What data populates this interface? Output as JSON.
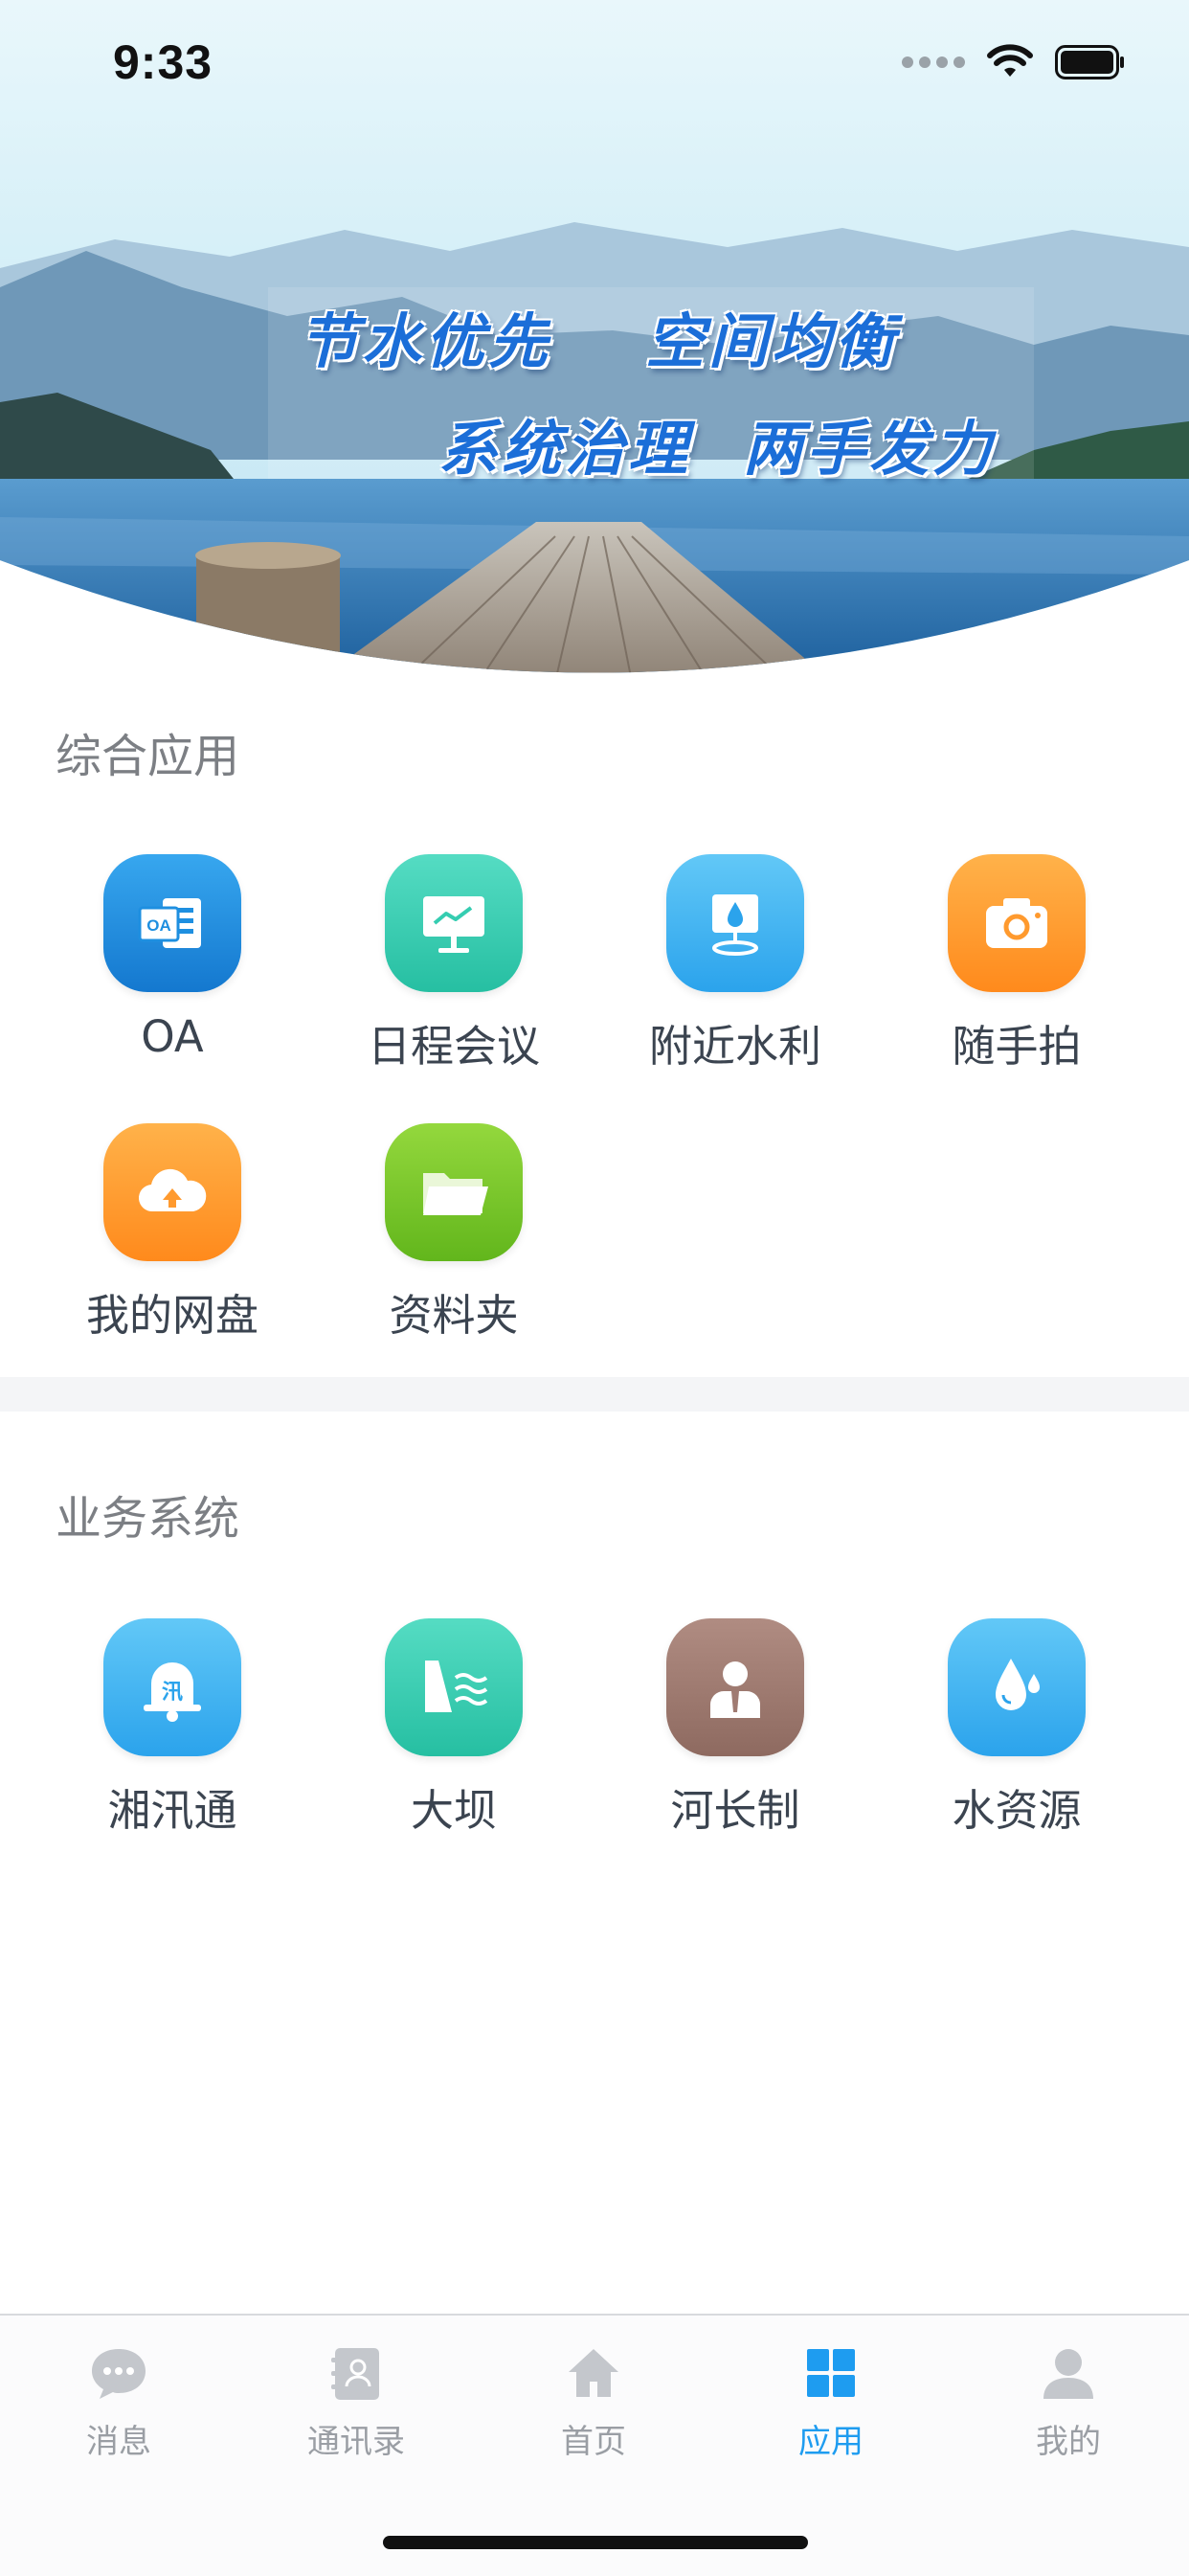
{
  "status_bar": {
    "time": "9:33"
  },
  "banner": {
    "slogan_line1_a": "节水优先",
    "slogan_line1_b": "空间均衡",
    "slogan_line2_a": "系统治理",
    "slogan_line2_b": "两手发力"
  },
  "section_general": {
    "title": "综合应用",
    "apps": [
      {
        "label": "OA",
        "icon": "oa-icon",
        "color": "#1e8fe0"
      },
      {
        "label": "日程会议",
        "icon": "meeting-board-icon",
        "color": "#35cdb1"
      },
      {
        "label": "附近水利",
        "icon": "location-water-icon",
        "color": "#3fb3f2"
      },
      {
        "label": "随手拍",
        "icon": "camera-icon",
        "color": "#ff9a2e"
      },
      {
        "label": "我的网盘",
        "icon": "cloud-upload-icon",
        "color": "#ff9a2e"
      },
      {
        "label": "资料夹",
        "icon": "folder-icon",
        "color": "#7ccb2a"
      }
    ]
  },
  "section_business": {
    "title": "业务系统",
    "apps": [
      {
        "label": "湘汛通",
        "icon": "flood-bell-icon",
        "color": "#3fb3f2"
      },
      {
        "label": "大坝",
        "icon": "dam-icon",
        "color": "#35cdb1"
      },
      {
        "label": "河长制",
        "icon": "river-chief-icon",
        "color": "#a07b72"
      },
      {
        "label": "水资源",
        "icon": "water-drop-icon",
        "color": "#3fb3f2"
      }
    ]
  },
  "tab_bar": {
    "tabs": [
      {
        "label": "消息",
        "icon": "chat-bubble-icon",
        "active": false
      },
      {
        "label": "通讯录",
        "icon": "contacts-book-icon",
        "active": false
      },
      {
        "label": "首页",
        "icon": "home-icon",
        "active": false
      },
      {
        "label": "应用",
        "icon": "apps-grid-icon",
        "active": true
      },
      {
        "label": "我的",
        "icon": "person-icon",
        "active": false
      }
    ],
    "active_color": "#1e9cf0",
    "inactive_color": "#9a9ea4"
  }
}
